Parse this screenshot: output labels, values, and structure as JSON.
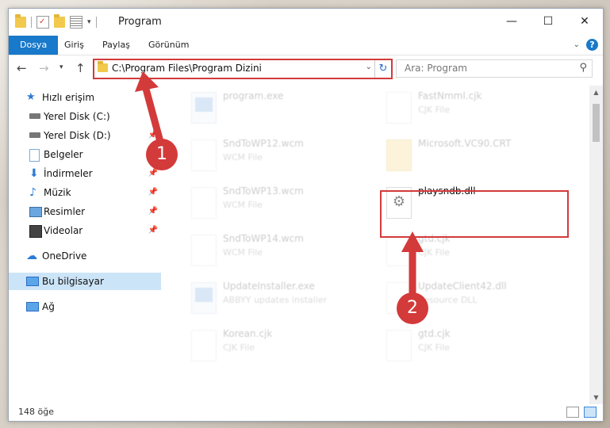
{
  "window": {
    "title": "Program"
  },
  "ribbon": {
    "tabs": [
      "Dosya",
      "Giriş",
      "Paylaş",
      "Görünüm"
    ],
    "help": "?"
  },
  "address": {
    "path": "C:\\Program Files\\Program Dizini"
  },
  "search": {
    "placeholder": "Ara: Program"
  },
  "nav": {
    "items": [
      {
        "label": "Hızlı erişim",
        "icon": "star-icon"
      },
      {
        "label": "Yerel Disk (C:)",
        "icon": "drive-icon"
      },
      {
        "label": "Yerel Disk (D:)",
        "icon": "drive-icon"
      },
      {
        "label": "Belgeler",
        "icon": "document-icon"
      },
      {
        "label": "İndirmeler",
        "icon": "download-icon"
      },
      {
        "label": "Müzik",
        "icon": "music-icon"
      },
      {
        "label": "Resimler",
        "icon": "pictures-icon"
      },
      {
        "label": "Videolar",
        "icon": "video-icon"
      },
      {
        "label": "OneDrive",
        "icon": "cloud-icon"
      },
      {
        "label": "Bu bilgisayar",
        "icon": "computer-icon"
      },
      {
        "label": "Ağ",
        "icon": "network-icon"
      }
    ]
  },
  "files": [
    {
      "name": "program.exe",
      "type": ""
    },
    {
      "name": "FastNmml.cjk",
      "type": "CJK File"
    },
    {
      "name": "SndToWP12.wcm",
      "type": "WCM File"
    },
    {
      "name": "Microsoft.VC90.CRT",
      "type": ""
    },
    {
      "name": "SndToWP13.wcm",
      "type": "WCM File"
    },
    {
      "name": "playsndb.dll",
      "type": ""
    },
    {
      "name": "SndToWP14.wcm",
      "type": "WCM File"
    },
    {
      "name": "gtd.cjk",
      "type": "CJK File"
    },
    {
      "name": "UpdateInstaller.exe",
      "type": "ABBYY updates installer"
    },
    {
      "name": "UpdateClient42.dll",
      "type": "Resource DLL"
    },
    {
      "name": "Korean.cjk",
      "type": "CJK File"
    },
    {
      "name": "gtd.cjk",
      "type": "CJK File"
    }
  ],
  "status": {
    "count": "148 öğe"
  },
  "annotations": {
    "step1": "1",
    "step2": "2"
  },
  "colors": {
    "accent": "#1979ca",
    "highlight": "#d33a3a"
  }
}
